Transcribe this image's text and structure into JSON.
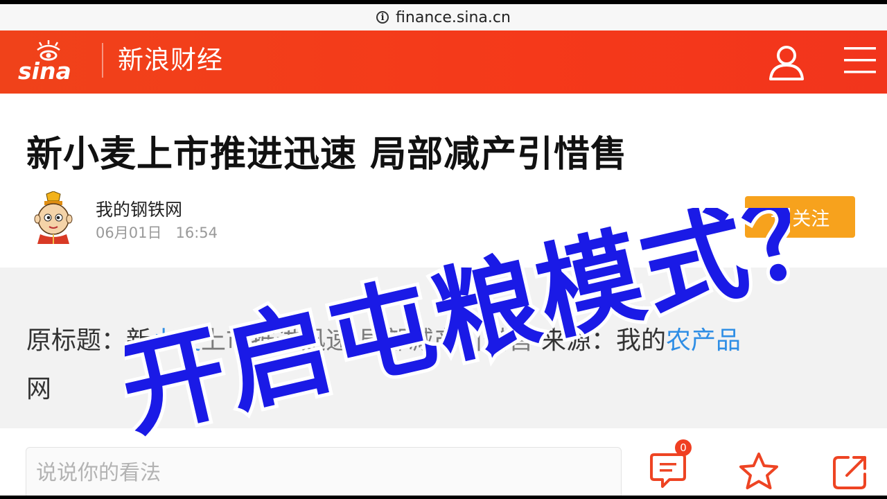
{
  "browser": {
    "url": "finance.sina.cn"
  },
  "header": {
    "brand_logo": "sina",
    "title": "新浪财经"
  },
  "article": {
    "title": "新小麦上市推进迅速 局部减产引惜售",
    "author": "我的钢铁网",
    "date": "06月01日",
    "time": "16:54",
    "follow_label": "关注",
    "content": {
      "prefix": "原标题：",
      "seg1": "新",
      "seg2_link": "小麦",
      "seg3_obscured": "上市推进迅速 局部减产引惜售",
      "seg4": " 来源：我的",
      "seg5_link": "农产品",
      "line2": "网"
    }
  },
  "overlay_caption": "开启屯粮模式？",
  "comment": {
    "placeholder": "说说你的看法",
    "count": "0"
  },
  "colors": {
    "header": "#f23a1b",
    "follow": "#f7a21d",
    "link": "#2f8ee5",
    "overlay_fill": "#1a1ae6"
  }
}
